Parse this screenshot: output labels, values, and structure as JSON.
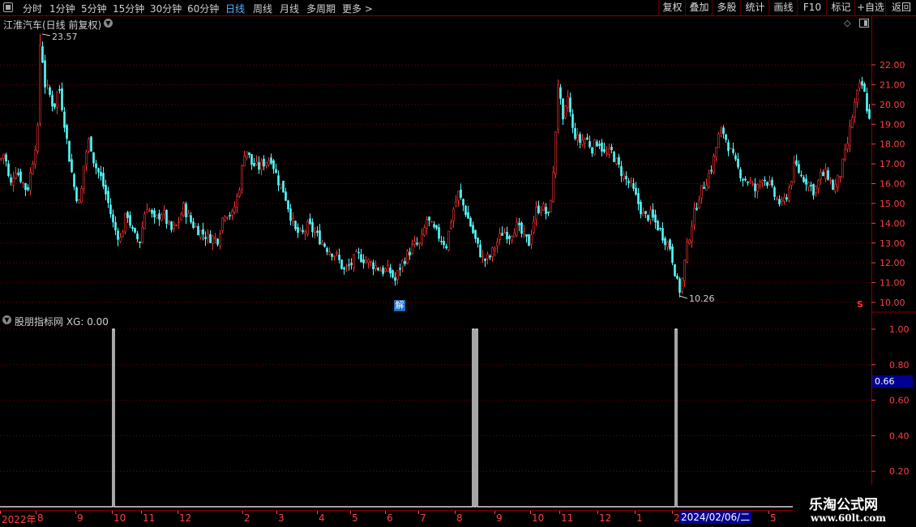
{
  "toolbar": {
    "periods": [
      {
        "label": "分时",
        "active": false
      },
      {
        "label": "1分钟",
        "active": false
      },
      {
        "label": "5分钟",
        "active": false
      },
      {
        "label": "15分钟",
        "active": false
      },
      {
        "label": "30分钟",
        "active": false
      },
      {
        "label": "60分钟",
        "active": false
      },
      {
        "label": "日线",
        "active": true
      },
      {
        "label": "周线",
        "active": false
      },
      {
        "label": "月线",
        "active": false
      },
      {
        "label": "多周期",
        "active": false
      },
      {
        "label": "更多 >",
        "active": false
      }
    ],
    "tools": [
      "复权",
      "叠加",
      "多股",
      "统计",
      "画线",
      "F10",
      "标记",
      "+自选",
      "返回"
    ]
  },
  "stock": {
    "title": "江淮汽车(日线 前复权)",
    "high_label": "23.57",
    "low_label": "10.26",
    "unlock_badge": "解",
    "signal_marker": "S"
  },
  "indicator": {
    "title": "股朋指标网",
    "xg_label": "XG: 0.00",
    "cursor_value": "0.66"
  },
  "colors": {
    "up": "#ff3232",
    "down": "#54fcfc",
    "grid": "#8a0000",
    "axis_text": "#ff4040",
    "signal": "#ffffff"
  },
  "date_axis": {
    "labels": [
      "2022年",
      "8",
      "9",
      "10",
      "11",
      "12",
      "2",
      "3",
      "4",
      "5",
      "6",
      "7",
      "8",
      "9",
      "10",
      "11",
      "12",
      "1",
      "2",
      "5"
    ],
    "cursor_date": "2024/02/06/二"
  },
  "watermark": {
    "title": "乐淘公式网",
    "url": "www.60lt.com"
  },
  "chart_data": [
    {
      "type": "candlestick",
      "title": "江淮汽车(日线 前复权)",
      "y_ticks": [
        22.0,
        21.0,
        20.0,
        19.0,
        18.0,
        17.0,
        16.0,
        15.0,
        14.0,
        13.0,
        12.0,
        11.0,
        10.0
      ],
      "ylim": [
        9.5,
        23.8
      ],
      "marked_high": 23.57,
      "marked_low": 10.26,
      "close_path": [
        [
          0,
          17.2
        ],
        [
          5,
          17.6
        ],
        [
          12,
          15.8
        ],
        [
          18,
          16.8
        ],
        [
          26,
          16.2
        ],
        [
          33,
          15.6
        ],
        [
          40,
          17.2
        ],
        [
          46,
          18.7
        ],
        [
          50,
          23.1
        ],
        [
          55,
          21.0
        ],
        [
          60,
          20.6
        ],
        [
          66,
          19.8
        ],
        [
          72,
          21.0
        ],
        [
          78,
          19.4
        ],
        [
          85,
          17.3
        ],
        [
          92,
          15.6
        ],
        [
          98,
          14.9
        ],
        [
          104,
          17.3
        ],
        [
          110,
          18.3
        ],
        [
          116,
          17.0
        ],
        [
          124,
          16.3
        ],
        [
          132,
          15.2
        ],
        [
          140,
          13.8
        ],
        [
          148,
          13.2
        ],
        [
          156,
          14.6
        ],
        [
          164,
          13.4
        ],
        [
          172,
          13.1
        ],
        [
          180,
          15.0
        ],
        [
          190,
          14.1
        ],
        [
          200,
          14.6
        ],
        [
          210,
          13.6
        ],
        [
          218,
          13.9
        ],
        [
          226,
          14.8
        ],
        [
          236,
          14.0
        ],
        [
          246,
          13.6
        ],
        [
          256,
          13.3
        ],
        [
          268,
          13.2
        ],
        [
          276,
          14.6
        ],
        [
          286,
          14.4
        ],
        [
          294,
          15.6
        ],
        [
          302,
          17.9
        ],
        [
          310,
          17.0
        ],
        [
          318,
          16.8
        ],
        [
          326,
          17.1
        ],
        [
          334,
          17.3
        ],
        [
          342,
          16.2
        ],
        [
          350,
          15.6
        ],
        [
          358,
          14.4
        ],
        [
          364,
          13.6
        ],
        [
          372,
          13.4
        ],
        [
          380,
          13.9
        ],
        [
          388,
          13.5
        ],
        [
          396,
          13.1
        ],
        [
          404,
          12.7
        ],
        [
          414,
          12.4
        ],
        [
          424,
          11.6
        ],
        [
          432,
          11.9
        ],
        [
          440,
          12.4
        ],
        [
          448,
          12.2
        ],
        [
          456,
          12.0
        ],
        [
          464,
          11.8
        ],
        [
          472,
          11.6
        ],
        [
          480,
          11.6
        ],
        [
          487,
          11.1
        ],
        [
          494,
          11.9
        ],
        [
          502,
          12.4
        ],
        [
          510,
          12.9
        ],
        [
          518,
          12.9
        ],
        [
          526,
          14.2
        ],
        [
          534,
          13.7
        ],
        [
          542,
          13.3
        ],
        [
          550,
          12.9
        ],
        [
          558,
          14.6
        ],
        [
          565,
          15.5
        ],
        [
          572,
          14.8
        ],
        [
          580,
          13.9
        ],
        [
          588,
          12.9
        ],
        [
          596,
          12.1
        ],
        [
          604,
          12.3
        ],
        [
          612,
          13.0
        ],
        [
          620,
          13.6
        ],
        [
          628,
          13.4
        ],
        [
          636,
          13.9
        ],
        [
          644,
          13.4
        ],
        [
          652,
          13.0
        ],
        [
          660,
          14.6
        ],
        [
          668,
          14.9
        ],
        [
          676,
          14.3
        ],
        [
          682,
          16.4
        ],
        [
          688,
          21.1
        ],
        [
          694,
          19.0
        ],
        [
          700,
          20.4
        ],
        [
          706,
          18.7
        ],
        [
          714,
          18.1
        ],
        [
          722,
          18.3
        ],
        [
          730,
          17.8
        ],
        [
          738,
          18.2
        ],
        [
          746,
          17.4
        ],
        [
          754,
          17.6
        ],
        [
          762,
          16.9
        ],
        [
          770,
          16.3
        ],
        [
          778,
          15.9
        ],
        [
          786,
          15.1
        ],
        [
          794,
          14.3
        ],
        [
          802,
          14.4
        ],
        [
          810,
          13.9
        ],
        [
          818,
          13.3
        ],
        [
          826,
          12.8
        ],
        [
          832,
          11.6
        ],
        [
          838,
          10.3
        ],
        [
          846,
          12.6
        ],
        [
          854,
          14.2
        ],
        [
          862,
          15.4
        ],
        [
          870,
          16.1
        ],
        [
          878,
          16.9
        ],
        [
          886,
          18.4
        ],
        [
          892,
          18.6
        ],
        [
          900,
          17.7
        ],
        [
          908,
          16.9
        ],
        [
          916,
          16.3
        ],
        [
          924,
          16.1
        ],
        [
          932,
          15.6
        ],
        [
          940,
          16.4
        ],
        [
          948,
          16.0
        ],
        [
          956,
          15.3
        ],
        [
          964,
          14.9
        ],
        [
          972,
          15.6
        ],
        [
          980,
          17.0
        ],
        [
          988,
          16.4
        ],
        [
          996,
          16.1
        ],
        [
          1004,
          15.6
        ],
        [
          1012,
          16.4
        ],
        [
          1020,
          16.5
        ],
        [
          1028,
          15.7
        ],
        [
          1036,
          16.5
        ],
        [
          1044,
          17.8
        ],
        [
          1050,
          19.2
        ],
        [
          1056,
          20.4
        ],
        [
          1062,
          21.1
        ],
        [
          1066,
          20.5
        ],
        [
          1072,
          19.2
        ]
      ]
    },
    {
      "type": "line",
      "title": "股朋指标网",
      "series": [
        {
          "name": "XG",
          "values": "spikes to 1.00 at three signals, otherwise 0.00"
        }
      ],
      "y_ticks": [
        1.0,
        0.8,
        0.6,
        0.4,
        0.2
      ],
      "ylim": [
        0,
        1.05
      ],
      "spikes": [
        {
          "x_index": 140,
          "value": 1.0
        },
        {
          "x_index": 584,
          "value": 1.0
        },
        {
          "x_index": 588,
          "value": 1.0
        },
        {
          "x_index": 834,
          "value": 1.0
        }
      ]
    }
  ]
}
